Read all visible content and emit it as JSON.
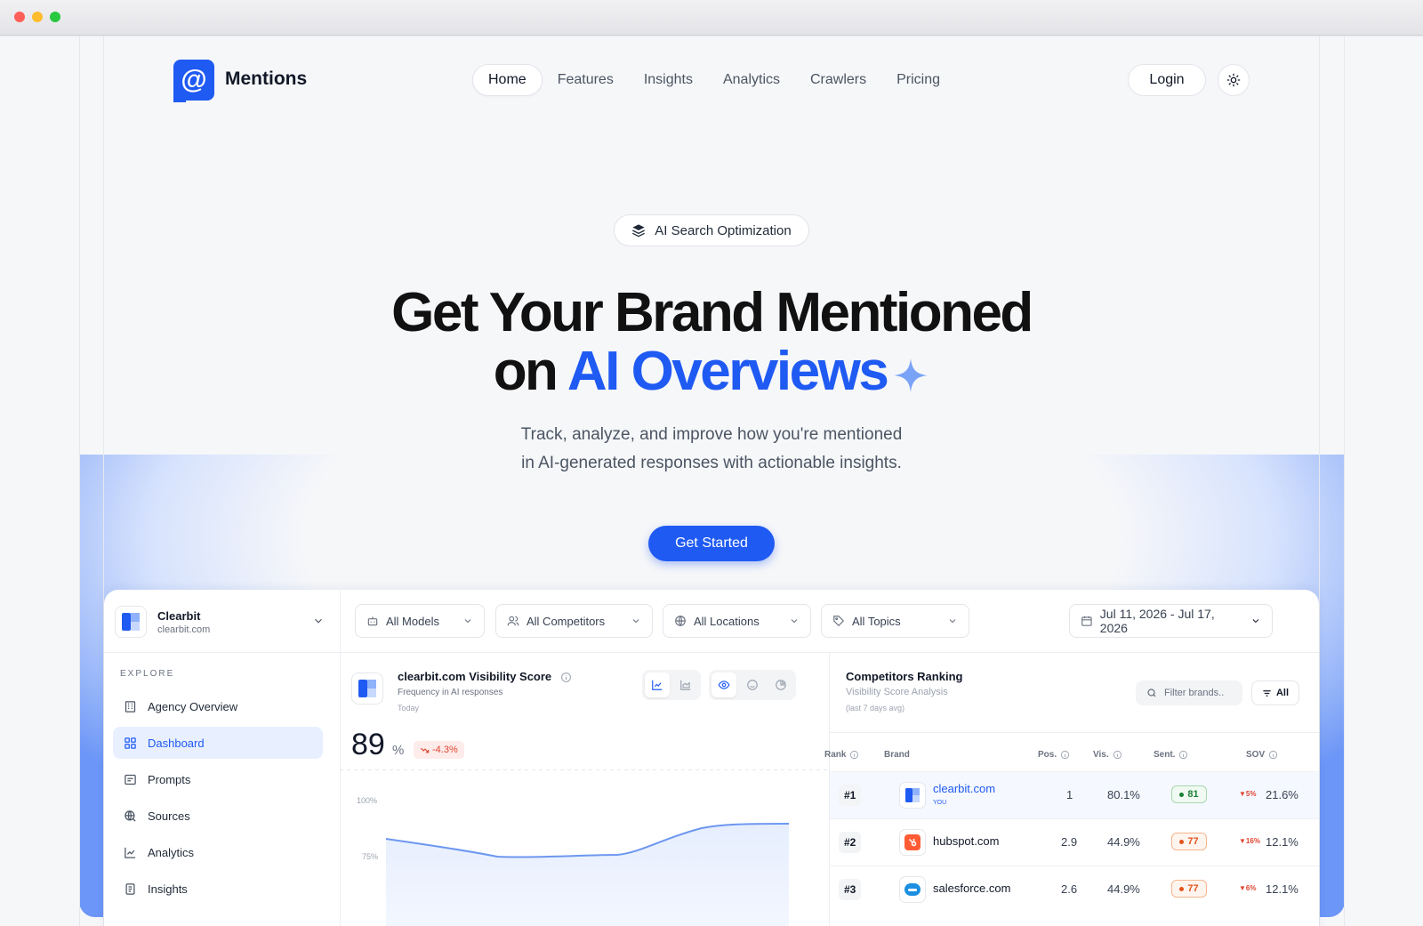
{
  "brand": {
    "name": "Mentions",
    "logo_glyph": "@",
    "accent": "#1f5af2"
  },
  "nav": {
    "items": [
      "Home",
      "Features",
      "Insights",
      "Analytics",
      "Crawlers",
      "Pricing"
    ],
    "active": "Home"
  },
  "header": {
    "login_label": "Login",
    "theme_icon": "sun-icon"
  },
  "hero": {
    "badge": "AI Search Optimization",
    "title_line1": "Get Your Brand Mentioned",
    "title_line2_prefix": "on ",
    "title_line2_highlight": "AI Overviews",
    "subtitle_line1": "Track, analyze, and improve how you're mentioned",
    "subtitle_line2": "in AI-generated responses with actionable insights.",
    "cta_label": "Get Started"
  },
  "dashboard": {
    "org": {
      "name": "Clearbit",
      "domain": "clearbit.com"
    },
    "filters": {
      "models": "All Models",
      "competitors": "All Competitors",
      "locations": "All Locations",
      "topics": "All Topics",
      "date_range": "Jul 11, 2026 - Jul 17, 2026"
    },
    "sidebar": {
      "section": "EXPLORE",
      "items": [
        {
          "label": "Agency Overview",
          "icon": "building-icon"
        },
        {
          "label": "Dashboard",
          "icon": "grid-icon",
          "active": true
        },
        {
          "label": "Prompts",
          "icon": "message-icon"
        },
        {
          "label": "Sources",
          "icon": "globe-search-icon"
        },
        {
          "label": "Analytics",
          "icon": "line-chart-icon"
        },
        {
          "label": "Insights",
          "icon": "document-icon"
        }
      ]
    },
    "visibility": {
      "title": "clearbit.com Visibility Score",
      "subtitle": "Frequency in AI responses",
      "period": "Today",
      "score": "89",
      "unit": "%",
      "delta": "-4.3%",
      "y_ticks": [
        "100%",
        "75%"
      ]
    },
    "competitors": {
      "title": "Competitors Ranking",
      "subtitle": "Visibility Score Analysis",
      "note": "(last 7 days avg)",
      "search_placeholder": "Filter brands..",
      "filter_label": "All",
      "columns": [
        "Rank",
        "Brand",
        "Pos.",
        "Vis.",
        "Sent.",
        "SOV"
      ],
      "rows": [
        {
          "rank": "#1",
          "brand": "clearbit.com",
          "tag": "YOU",
          "pos": "1",
          "vis": "80.1%",
          "sent": "81",
          "sent_tone": "green",
          "sov_delta": "5%",
          "sov": "21.6%"
        },
        {
          "rank": "#2",
          "brand": "hubspot.com",
          "tag": "",
          "pos": "2.9",
          "vis": "44.9%",
          "sent": "77",
          "sent_tone": "orange",
          "sov_delta": "16%",
          "sov": "12.1%"
        },
        {
          "rank": "#3",
          "brand": "salesforce.com",
          "tag": "",
          "pos": "2.6",
          "vis": "44.9%",
          "sent": "77",
          "sent_tone": "orange",
          "sov_delta": "6%",
          "sov": "12.1%"
        }
      ]
    }
  }
}
